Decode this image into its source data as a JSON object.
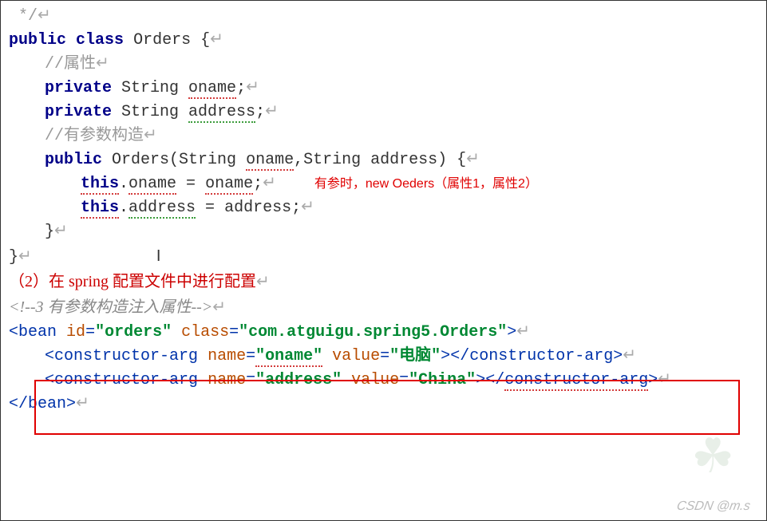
{
  "code": {
    "l0": " */",
    "kw_public": "public",
    "kw_class": "class",
    "kw_private": "private",
    "class_name": "Orders",
    "open_brace": " {",
    "comment_prop": "//属性",
    "type_string": "String ",
    "field_oname": "oname",
    "field_address": "address",
    "semicolon": ";",
    "comment_cons": "//有参数构造",
    "cons_sig_open": "(String ",
    "comma": ",",
    "cons_sig_close": ") {",
    "kw_this": "this",
    "dot": ".",
    "equals": " = ",
    "close_brace": "}",
    "cursor": "I"
  },
  "annotation": {
    "red_note": "有参时，new Oeders（属性1，属性2）",
    "step2": "（2）在 spring 配置文件中进行配置"
  },
  "xml": {
    "comment": "<!--3 有参数构造注入属性-->",
    "tag_bean_open": "bean",
    "attr_id_name": "id",
    "attr_id_val": "\"orders\"",
    "attr_class_name": "class",
    "attr_class_val": "\"com.atguigu.spring5.Orders\"",
    "tag_cons": "constructor-arg",
    "attr_name": "name",
    "val_oname": "\"oname\"",
    "attr_value": "value",
    "val_dian_nao": "\"电脑\"",
    "val_address": "\"address\"",
    "val_china": "\"China\"",
    "close_tag": ">",
    "lt": "<",
    "gt": ">",
    "slash": "/",
    "eq": "="
  },
  "footer": {
    "watermark": "CSDN @m.s"
  },
  "pm": "↵"
}
